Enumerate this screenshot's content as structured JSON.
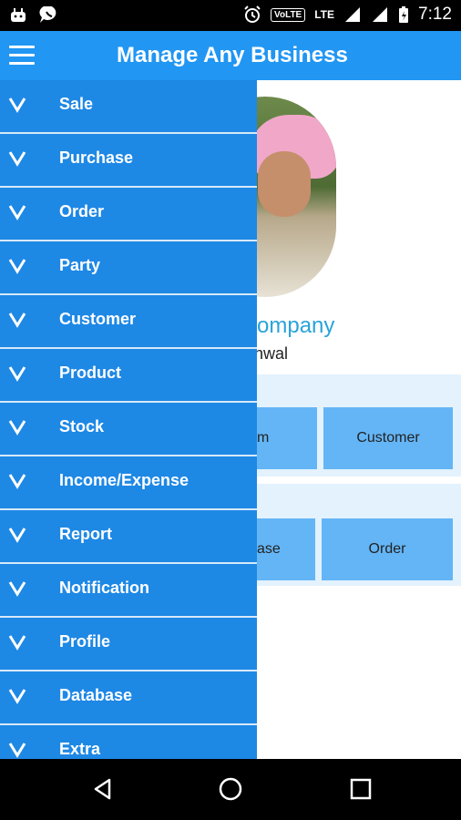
{
  "status_bar": {
    "volte": "VoLTE",
    "lte": "LTE",
    "time": "7:12"
  },
  "app_bar": {
    "title": "Manage Any Business"
  },
  "drawer": {
    "items": [
      {
        "label": "Sale"
      },
      {
        "label": "Purchase"
      },
      {
        "label": "Order"
      },
      {
        "label": "Party"
      },
      {
        "label": "Customer"
      },
      {
        "label": "Product"
      },
      {
        "label": "Stock"
      },
      {
        "label": "Income/Expense"
      },
      {
        "label": "Report"
      },
      {
        "label": "Notification"
      },
      {
        "label": "Profile"
      },
      {
        "label": "Database"
      },
      {
        "label": "Extra"
      }
    ]
  },
  "main": {
    "company_text": "g company",
    "person_text": "khwal",
    "tiles": {
      "row1_fragment": "m",
      "customer": "Customer",
      "row2_fragment": "ase",
      "order": "Order"
    }
  },
  "colors": {
    "app_bar": "#2196f3",
    "drawer": "#1e88e5",
    "company_text": "#29a3d9",
    "panel": "#e3f2fd",
    "tile": "#64b5f6"
  },
  "icons": {
    "menu": "hamburger-icon",
    "drawer_chevron": "chevron-down-icon",
    "nav_back": "back-icon",
    "nav_home": "home-icon",
    "nav_recent": "recent-apps-icon"
  }
}
